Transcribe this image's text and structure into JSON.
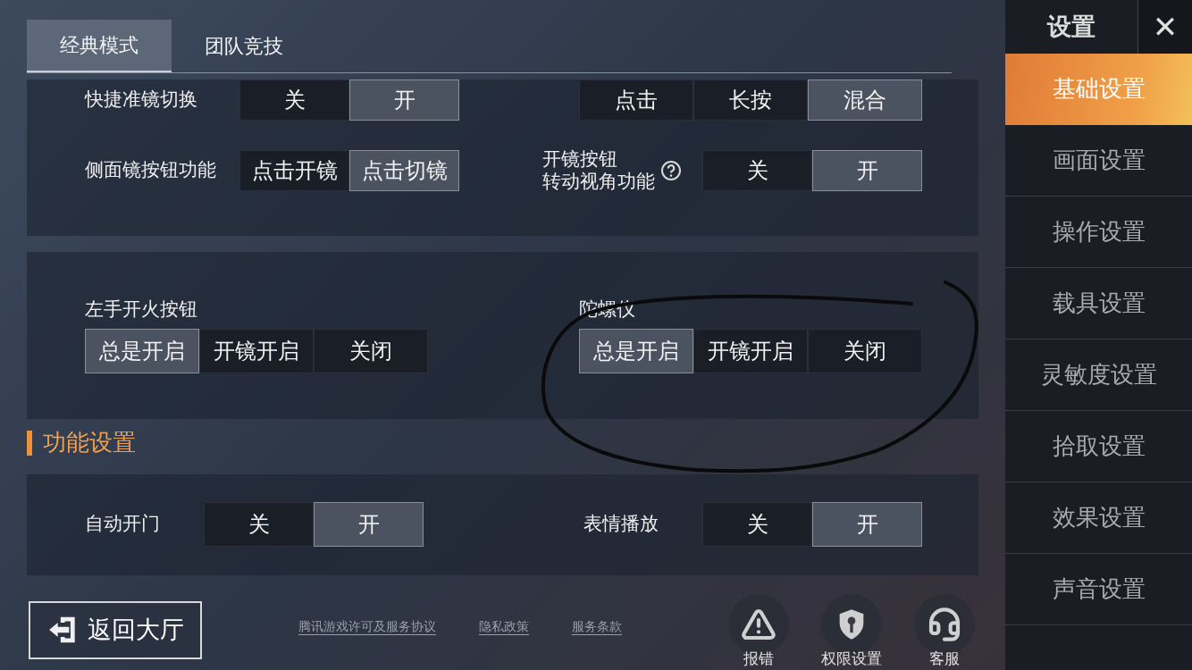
{
  "tabs": [
    {
      "label": "经典模式",
      "selected": true
    },
    {
      "label": "团队竞技",
      "selected": false
    }
  ],
  "panels": [
    {
      "kind": "inline",
      "settings": [
        {
          "label": "快捷准镜切换",
          "options": [
            {
              "label": "关",
              "selected": false
            },
            {
              "label": "开",
              "selected": true
            }
          ]
        },
        {
          "options": [
            {
              "label": "点击",
              "selected": false
            },
            {
              "label": "长按",
              "selected": false
            },
            {
              "label": "混合",
              "selected": true
            }
          ]
        },
        {
          "label": "侧面镜按钮功能",
          "options": [
            {
              "label": "点击开镜",
              "selected": false
            },
            {
              "label": "点击切镜",
              "selected": true
            }
          ]
        },
        {
          "label_lines": [
            "开镜按钮",
            "转动视角功能"
          ],
          "help": true,
          "options": [
            {
              "label": "关",
              "selected": false
            },
            {
              "label": "开",
              "selected": true
            }
          ]
        }
      ]
    },
    {
      "kind": "stacked",
      "settings": [
        {
          "label": "左手开火按钮",
          "options": [
            {
              "label": "总是开启",
              "selected": true
            },
            {
              "label": "开镜开启",
              "selected": false
            },
            {
              "label": "关闭",
              "selected": false
            }
          ]
        },
        {
          "label": "陀螺仪",
          "options": [
            {
              "label": "总是开启",
              "selected": true
            },
            {
              "label": "开镜开启",
              "selected": false
            },
            {
              "label": "关闭",
              "selected": false
            }
          ]
        }
      ]
    },
    {
      "kind": "section_header",
      "title": "功能设置"
    },
    {
      "kind": "compact",
      "settings": [
        {
          "label": "自动开门",
          "options": [
            {
              "label": "关",
              "selected": false
            },
            {
              "label": "开",
              "selected": true
            }
          ]
        },
        {
          "label": "表情播放",
          "options": [
            {
              "label": "关",
              "selected": false
            },
            {
              "label": "开",
              "selected": true
            }
          ]
        }
      ]
    }
  ],
  "back_button": "返回大厅",
  "links": [
    "腾讯游戏许可及服务协议",
    "隐私政策",
    "服务条款"
  ],
  "actions": [
    {
      "kind": "warning",
      "label": "报错"
    },
    {
      "kind": "shield",
      "label": "权限设置"
    },
    {
      "kind": "headset",
      "label": "客服"
    }
  ],
  "sidebar": {
    "title": "设置",
    "close": "✕",
    "items": [
      {
        "label": "基础设置",
        "selected": true
      },
      {
        "label": "画面设置",
        "selected": false
      },
      {
        "label": "操作设置",
        "selected": false
      },
      {
        "label": "载具设置",
        "selected": false
      },
      {
        "label": "灵敏度设置",
        "selected": false
      },
      {
        "label": "拾取设置",
        "selected": false
      },
      {
        "label": "效果设置",
        "selected": false
      },
      {
        "label": "声音设置",
        "selected": false
      }
    ]
  }
}
